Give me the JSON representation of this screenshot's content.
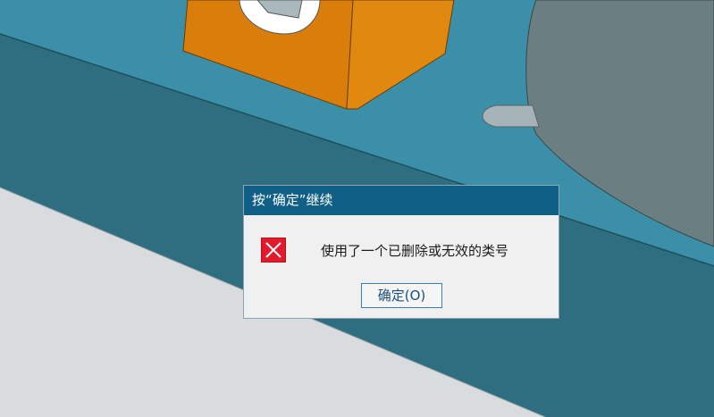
{
  "dialog": {
    "title": "按“确定”继续",
    "icon": "error-x-icon",
    "message": "使用了一个已删除或无效的类号",
    "ok_button_label": "确定(O)"
  },
  "colors": {
    "viewport_background": "#3b8fa8",
    "part_orange": "#d97e0b",
    "dialog_title_bar": "#0f5f86",
    "dialog_background": "#f0f0f0",
    "error_icon": "#e3192c"
  }
}
